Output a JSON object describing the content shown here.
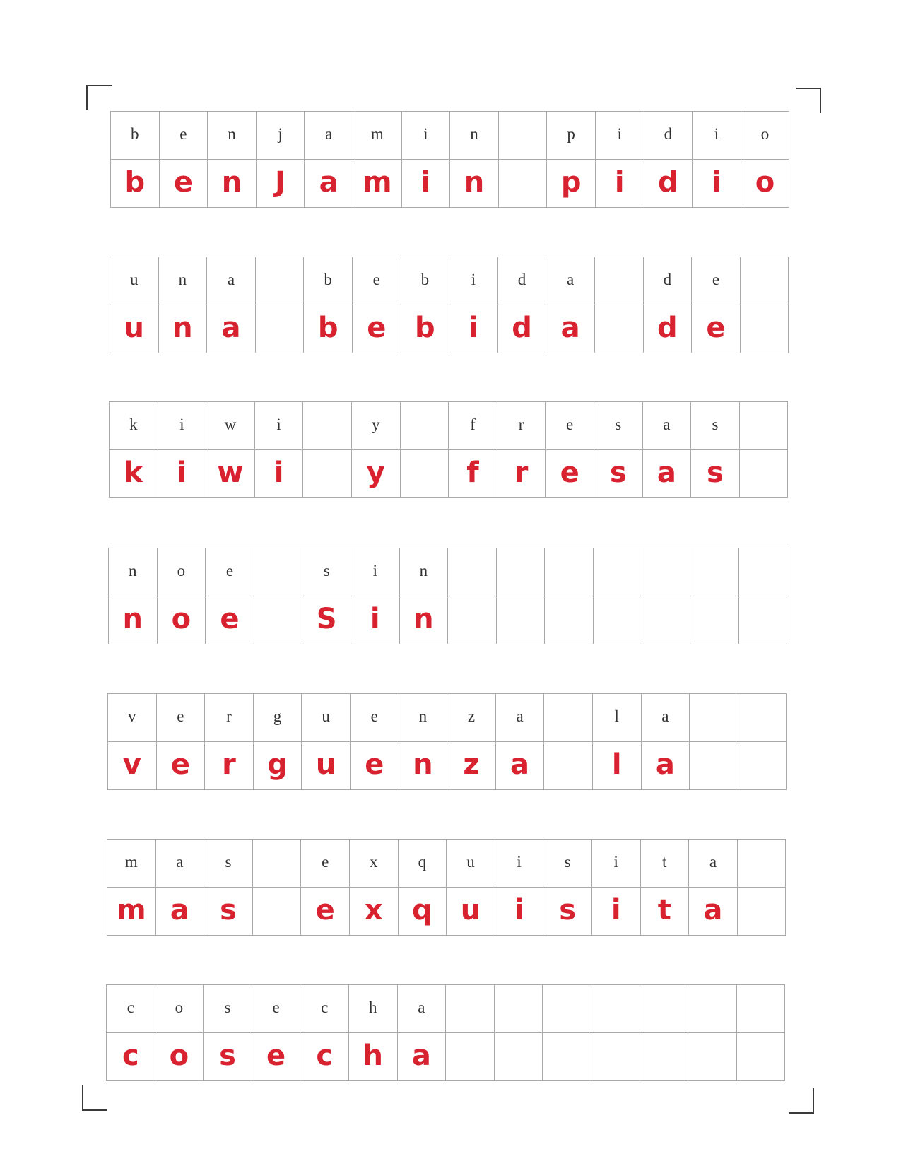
{
  "ink_color": "#d8222f",
  "printed_color": "#333333",
  "rows": [
    {
      "printed": [
        "b",
        "e",
        "n",
        "j",
        "a",
        "m",
        "i",
        "n",
        "",
        "p",
        "i",
        "d",
        "i",
        "o"
      ],
      "written": [
        "b",
        "e",
        "n",
        "J",
        "a",
        "m",
        "i",
        "n",
        "",
        "p",
        "i",
        "d",
        "i",
        "o"
      ]
    },
    {
      "printed": [
        "u",
        "n",
        "a",
        "",
        "b",
        "e",
        "b",
        "i",
        "d",
        "a",
        "",
        "d",
        "e",
        ""
      ],
      "written": [
        "u",
        "n",
        "a",
        "",
        "b",
        "e",
        "b",
        "i",
        "d",
        "a",
        "",
        "d",
        "e",
        ""
      ]
    },
    {
      "printed": [
        "k",
        "i",
        "w",
        "i",
        "",
        "y",
        "",
        "f",
        "r",
        "e",
        "s",
        "a",
        "s",
        ""
      ],
      "written": [
        "k",
        "i",
        "w",
        "i",
        "",
        "y",
        "",
        "f",
        "r",
        "e",
        "s",
        "a",
        "s",
        ""
      ]
    },
    {
      "printed": [
        "n",
        "o",
        "e",
        "",
        "s",
        "i",
        "n",
        "",
        "",
        "",
        "",
        "",
        "",
        ""
      ],
      "written": [
        "n",
        "o",
        "e",
        "",
        "S",
        "i",
        "n",
        "",
        "",
        "",
        "",
        "",
        "",
        ""
      ]
    },
    {
      "printed": [
        "v",
        "e",
        "r",
        "g",
        "u",
        "e",
        "n",
        "z",
        "a",
        "",
        "l",
        "a",
        "",
        ""
      ],
      "written": [
        "v",
        "e",
        "r",
        "g",
        "u",
        "e",
        "n",
        "z",
        "a",
        "",
        "l",
        "a",
        "",
        ""
      ]
    },
    {
      "printed": [
        "m",
        "a",
        "s",
        "",
        "e",
        "x",
        "q",
        "u",
        "i",
        "s",
        "i",
        "t",
        "a",
        ""
      ],
      "written": [
        "m",
        "a",
        "s",
        "",
        "e",
        "x",
        "q",
        "u",
        "i",
        "s",
        "i",
        "t",
        "a",
        ""
      ]
    },
    {
      "printed": [
        "c",
        "o",
        "s",
        "e",
        "c",
        "h",
        "a",
        "",
        "",
        "",
        "",
        "",
        "",
        ""
      ],
      "written": [
        "c",
        "o",
        "s",
        "e",
        "c",
        "h",
        "a",
        "",
        "",
        "",
        "",
        "",
        "",
        ""
      ]
    }
  ]
}
